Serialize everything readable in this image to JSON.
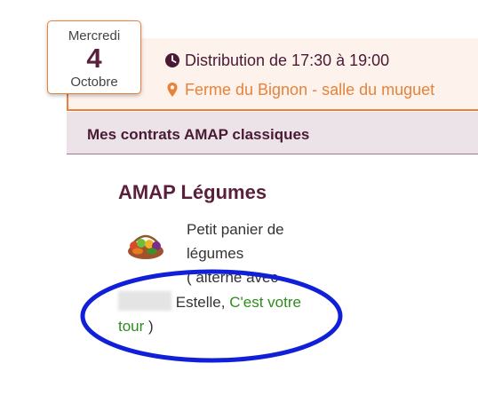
{
  "date": {
    "weekday": "Mercredi",
    "day": "4",
    "month": "Octobre"
  },
  "distribution": {
    "time_text": "Distribution de 17:30 à 19:00",
    "location_text": "Ferme du Bignon - salle du muguet"
  },
  "section": {
    "title": "Mes contrats AMAP classiques"
  },
  "product": {
    "title": "AMAP Légumes",
    "description": "Petit panier de légumes",
    "alternate_prefix": "( alterné avec",
    "alternate_name": "Estelle,",
    "turn_link_part1": "C'est votre",
    "turn_link_part2": "tour",
    "closing": ")"
  },
  "colors": {
    "accent_orange": "#e8823a",
    "brand_purple": "#5a1f3b",
    "link_green": "#2e8b1e",
    "annotation_blue": "#1020d8"
  }
}
